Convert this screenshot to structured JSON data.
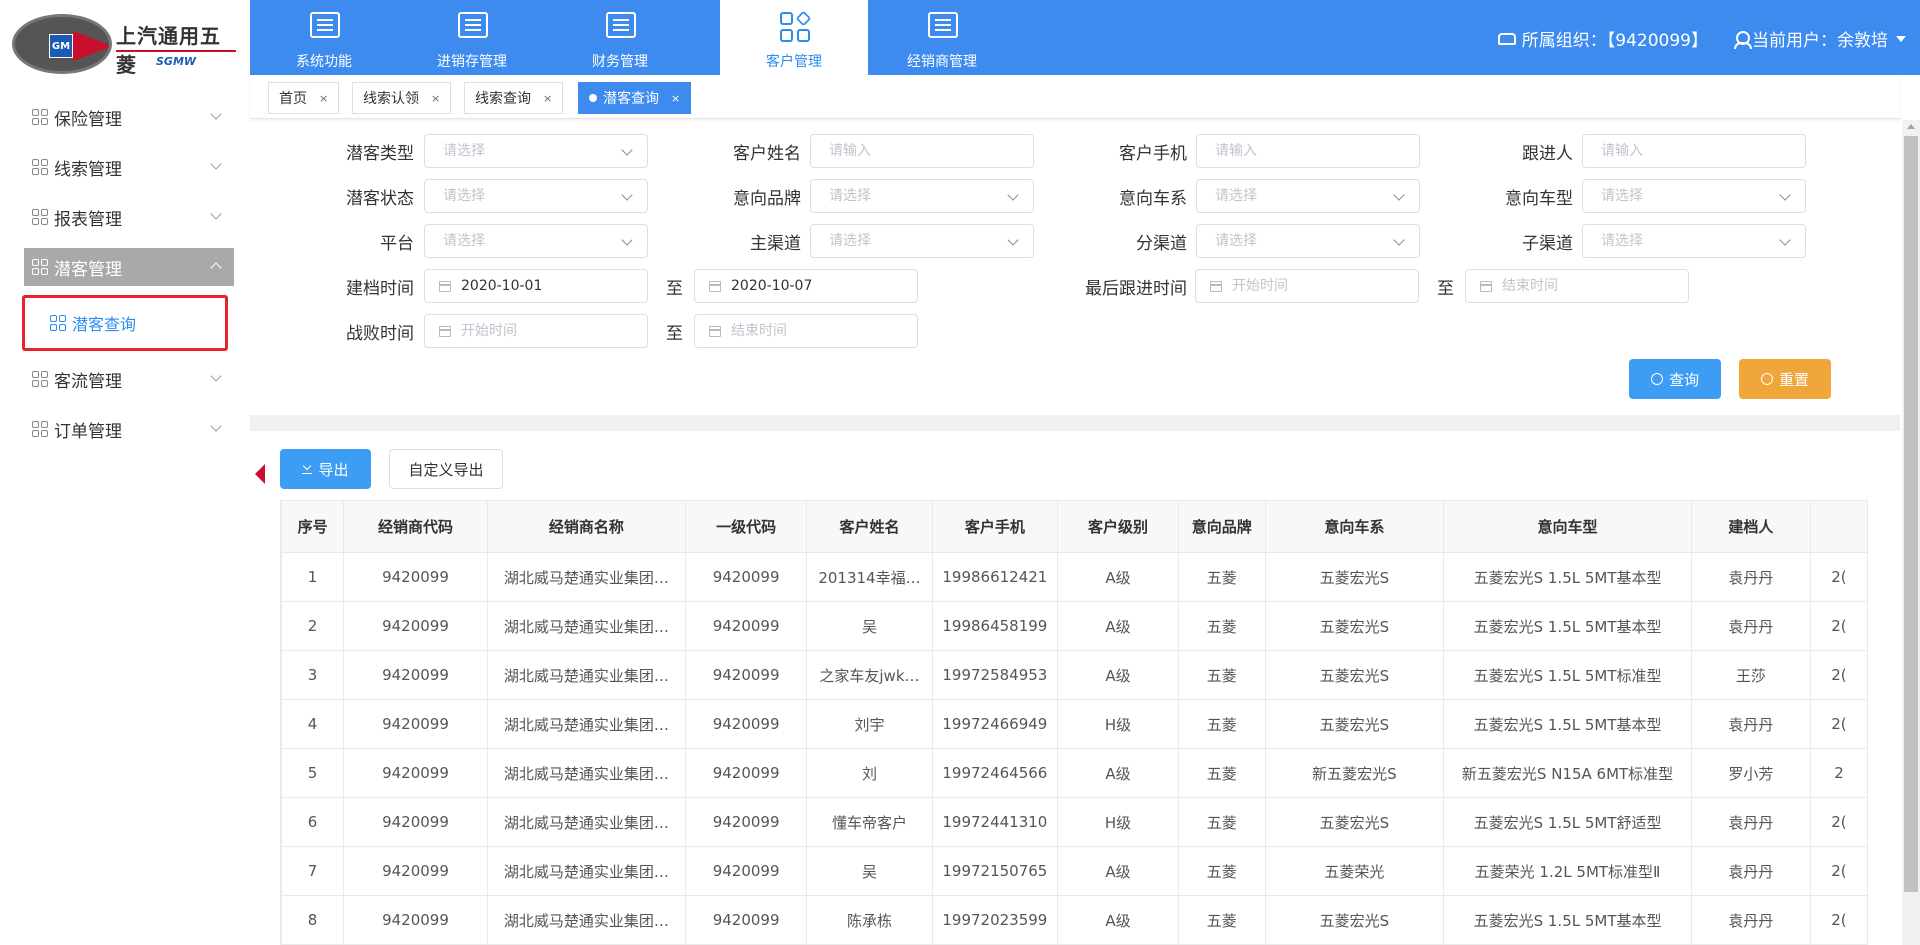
{
  "logo": {
    "badge": "GM",
    "name_cn": "上汽通用五菱",
    "name_en": "SGMW"
  },
  "topnav": [
    {
      "label": "系统功能"
    },
    {
      "label": "进销存管理"
    },
    {
      "label": "财务管理"
    },
    {
      "label": "客户管理"
    },
    {
      "label": "经销商管理"
    }
  ],
  "header": {
    "org_label": "所属组织：【9420099】",
    "user_label": "当前用户：余敦培"
  },
  "sidebar": {
    "items": [
      {
        "label": "保险管理"
      },
      {
        "label": "线索管理"
      },
      {
        "label": "报表管理"
      },
      {
        "label": "潜客管理"
      },
      {
        "label": "潜客查询"
      },
      {
        "label": "客流管理"
      },
      {
        "label": "订单管理"
      }
    ]
  },
  "tabs": [
    {
      "label": "首页",
      "close": "×"
    },
    {
      "label": "线索认领",
      "close": "×"
    },
    {
      "label": "线索查询",
      "close": "×"
    },
    {
      "label": "潜客查询",
      "close": "×"
    }
  ],
  "form": {
    "potential_type": {
      "label": "潜客类型",
      "placeholder": "请选择"
    },
    "customer_name": {
      "label": "客户姓名",
      "placeholder": "请输入"
    },
    "customer_phone": {
      "label": "客户手机",
      "placeholder": "请输入"
    },
    "follower": {
      "label": "跟进人",
      "placeholder": "请输入"
    },
    "potential_status": {
      "label": "潜客状态",
      "placeholder": "请选择"
    },
    "intent_brand": {
      "label": "意向品牌",
      "placeholder": "请选择"
    },
    "intent_series": {
      "label": "意向车系",
      "placeholder": "请选择"
    },
    "intent_model": {
      "label": "意向车型",
      "placeholder": "请选择"
    },
    "platform": {
      "label": "平台",
      "placeholder": "请选择"
    },
    "main_channel": {
      "label": "主渠道",
      "placeholder": "请选择"
    },
    "sub_channel": {
      "label": "分渠道",
      "placeholder": "请选择"
    },
    "child_channel": {
      "label": "子渠道",
      "placeholder": "请选择"
    },
    "create_time": {
      "label": "建档时间",
      "start": "2020-10-01",
      "end": "2020-10-07"
    },
    "last_follow_time": {
      "label": "最后跟进时间",
      "start_placeholder": "开始时间",
      "end_placeholder": "结束时间"
    },
    "defeat_time": {
      "label": "战败时间",
      "start_placeholder": "开始时间",
      "end_placeholder": "结束时间"
    },
    "to_label": "至",
    "query_button": "查询",
    "reset_button": "重置"
  },
  "toolbar": {
    "export_button": "导出",
    "custom_export_button": "自定义导出"
  },
  "table": {
    "columns": [
      "序号",
      "经销商代码",
      "经销商名称",
      "一级代码",
      "客户姓名",
      "客户手机",
      "客户级别",
      "意向品牌",
      "意向车系",
      "意向车型",
      "建档人",
      ""
    ],
    "rows": [
      [
        "1",
        "9420099",
        "湖北威马楚通实业集团…",
        "9420099",
        "201314幸福…",
        "19986612421",
        "A级",
        "五菱",
        "五菱宏光S",
        "五菱宏光S 1.5L 5MT基本型",
        "袁丹丹",
        "2("
      ],
      [
        "2",
        "9420099",
        "湖北威马楚通实业集团…",
        "9420099",
        "吴",
        "19986458199",
        "A级",
        "五菱",
        "五菱宏光S",
        "五菱宏光S 1.5L 5MT基本型",
        "袁丹丹",
        "2("
      ],
      [
        "3",
        "9420099",
        "湖北威马楚通实业集团…",
        "9420099",
        "之家车友jwk…",
        "19972584953",
        "A级",
        "五菱",
        "五菱宏光S",
        "五菱宏光S 1.5L 5MT标准型",
        "王莎",
        "2("
      ],
      [
        "4",
        "9420099",
        "湖北威马楚通实业集团…",
        "9420099",
        "刘宇",
        "19972466949",
        "H级",
        "五菱",
        "五菱宏光S",
        "五菱宏光S 1.5L 5MT基本型",
        "袁丹丹",
        "2("
      ],
      [
        "5",
        "9420099",
        "湖北威马楚通实业集团…",
        "9420099",
        "刘",
        "19972464566",
        "A级",
        "五菱",
        "新五菱宏光S",
        "新五菱宏光S N15A 6MT标准型",
        "罗小芳",
        "2"
      ],
      [
        "6",
        "9420099",
        "湖北威马楚通实业集团…",
        "9420099",
        "懂车帝客户",
        "19972441310",
        "H级",
        "五菱",
        "五菱宏光S",
        "五菱宏光S 1.5L 5MT舒适型",
        "袁丹丹",
        "2("
      ],
      [
        "7",
        "9420099",
        "湖北威马楚通实业集团…",
        "9420099",
        "吴",
        "19972150765",
        "A级",
        "五菱",
        "五菱荣光",
        "五菱荣光 1.2L 5MT标准型Ⅱ",
        "袁丹丹",
        "2("
      ],
      [
        "8",
        "9420099",
        "湖北威马楚通实业集团…",
        "9420099",
        "陈承栋",
        "19972023599",
        "A级",
        "五菱",
        "五菱宏光S",
        "五菱宏光S 1.5L 5MT基本型",
        "袁丹丹",
        "2("
      ]
    ]
  },
  "colors": {
    "primary": "#3d8bef",
    "warning": "#f0a63a",
    "highlight": "#e8232a"
  }
}
